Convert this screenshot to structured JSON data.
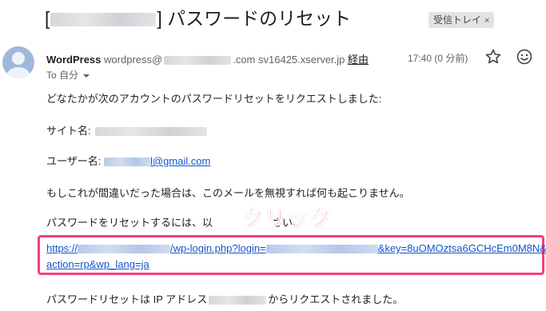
{
  "subject": {
    "bracket_open": "[",
    "bracket_close": "]",
    "title": "パスワードのリセット",
    "label": "受信トレイ",
    "label_remove": "×"
  },
  "sender": {
    "name": "WordPress",
    "address_prefix": "wordpress@",
    "address_suffix": ".com",
    "server": "sv16425.xserver.jp",
    "via": "経由",
    "to_line": "To 自分",
    "time": "17:40 (0 分前)"
  },
  "body": {
    "line1": "どなたかが次のアカウントのパスワードリセットをリクエストしました:",
    "site_label": "サイト名:",
    "username_label": "ユーザー名:",
    "username_email_suffix": "l@gmail.com",
    "line4": "もしこれが間違いだった場合は、このメールを無視すれば何も起こりません。",
    "line5_start": "パスワードをリセットするには、以",
    "line5_end": "さい。",
    "link_line1_prefix": "https://",
    "link_line1_mid": "/wp-login.php?login=",
    "link_line1_end": "&key=8uOMOztsa6GCHcEm0M8N&",
    "link_line2": "action=rp&wp_lang=ja",
    "ip_line_start": "パスワードリセットは IP アドレス",
    "ip_line_end": "からリクエストされました。"
  },
  "annotation": {
    "callout_text": "クリック",
    "color": "#f63f7a"
  },
  "colors": {
    "link": "#1155cc",
    "highlight": "#f63f7a",
    "badge_bg": "#e3e3e3"
  },
  "icons": [
    "star-icon",
    "emoji-icon",
    "chevron-down-icon",
    "avatar-icon"
  ]
}
